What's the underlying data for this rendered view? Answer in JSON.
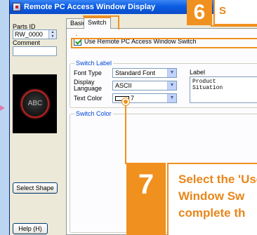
{
  "window": {
    "title": "Remote PC Access Window Display"
  },
  "left_panel": {
    "parts_id_label": "Parts ID",
    "parts_id_value": "RW_0000",
    "comment_label": "Comment",
    "comment_value": "",
    "preview_text": "ABC",
    "select_shape_label": "Select Shape",
    "help_label": "Help (H)"
  },
  "tabs": [
    {
      "label": "Basic",
      "active": false
    },
    {
      "label": "Switch",
      "active": true
    }
  ],
  "switch_tab": {
    "use_switch_label": "Use Remote PC Access Window Switch",
    "use_switch_checked": true,
    "switch_label_group": "Switch Label",
    "font_type_label": "Font Type",
    "font_type_value": "Standard Font",
    "display_language_label": "Display Language",
    "display_language_value": "ASCII",
    "text_color_label": "Text Color",
    "text_color_value": "7",
    "label_label": "Label",
    "label_text": "Product\nSituation",
    "switch_color_group": "Switch Color"
  },
  "annotations": {
    "step6_number": "6",
    "step6_text": "S",
    "step7_number": "7",
    "step7_text_line1": "Select the 'Use Remote PC Access",
    "step7_text_line2": "Window Sw",
    "step7_text_line3": "complete th"
  },
  "colors": {
    "accent": "#f0901e",
    "titlebar": "#0b5de3",
    "group_title": "#0046d5"
  }
}
